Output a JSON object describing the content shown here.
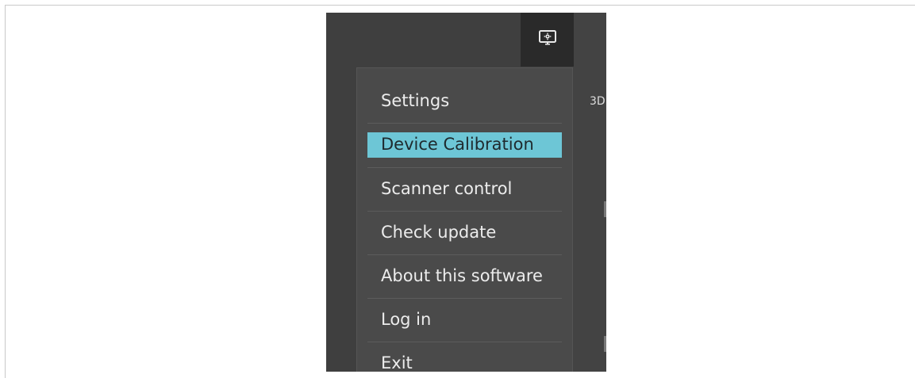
{
  "app": {
    "panel_label": "3D",
    "settings_icon": "settings-monitor-icon"
  },
  "menu": {
    "items": [
      {
        "label": "Settings",
        "selected": false
      },
      {
        "label": "Device Calibration",
        "selected": true
      },
      {
        "label": "Scanner control",
        "selected": false
      },
      {
        "label": "Check update",
        "selected": false
      },
      {
        "label": "About this software",
        "selected": false
      },
      {
        "label": "Log in",
        "selected": false
      },
      {
        "label": "Exit",
        "selected": false
      }
    ]
  },
  "colors": {
    "accent_highlight": "#6dc6d6",
    "menu_background": "#4a4a4a",
    "window_background": "#3f3f3f",
    "button_background": "#2a2a2a"
  }
}
